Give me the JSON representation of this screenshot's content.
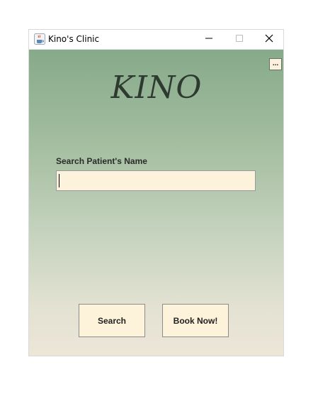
{
  "window": {
    "title": "Kino's Clinic",
    "icon": "java-coffee-cup-icon"
  },
  "titlebar_controls": {
    "minimize_icon": "minimize-icon",
    "maximize_icon": "maximize-icon",
    "close_icon": "close-icon"
  },
  "menu_button": {
    "label": "..."
  },
  "logo": {
    "text": "KINO"
  },
  "search": {
    "label": "Search Patient's Name",
    "value": "",
    "placeholder": ""
  },
  "actions": {
    "search_label": "Search",
    "book_label": "Book Now!"
  },
  "colors": {
    "gradient_top": "#86aa8a",
    "gradient_bottom": "#ece6d7",
    "button_fill": "#fdf2da",
    "input_fill": "#fdf3dc",
    "logo_text": "#2e3a2f"
  }
}
